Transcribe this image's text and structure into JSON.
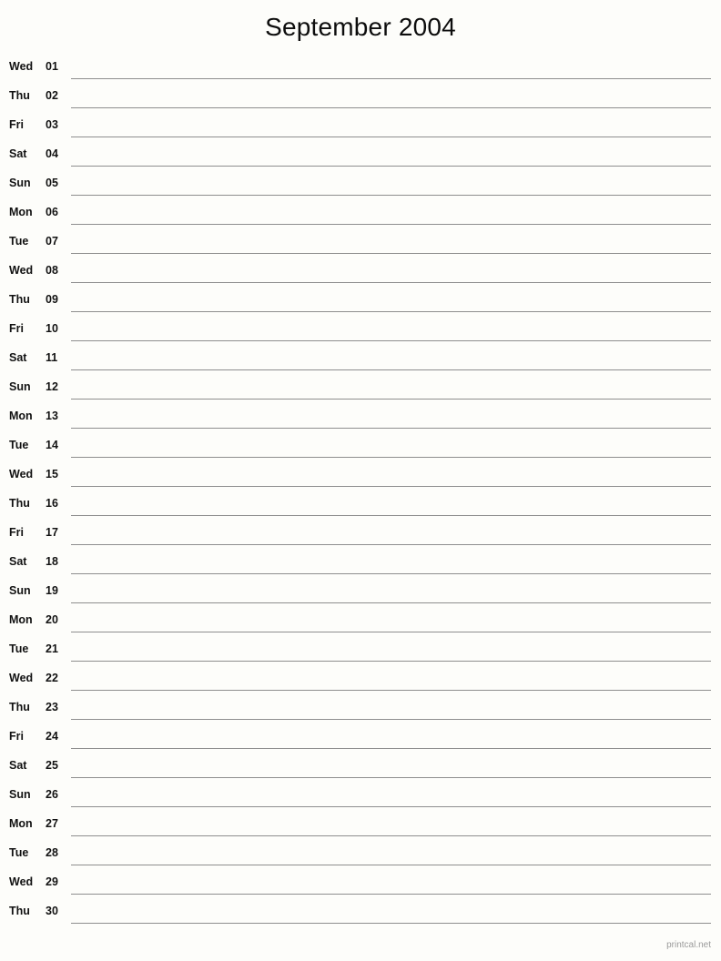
{
  "document": {
    "type": "printable-monthly-notes-calendar",
    "title": "September 2004",
    "month": "September",
    "year": "2004"
  },
  "footer": {
    "credit": "printcal.net"
  },
  "colors": {
    "background": "#fdfdfa",
    "text": "#121212",
    "rule_line": "#8e8e8e",
    "footer_text": "#9b9b9b"
  },
  "days": [
    {
      "weekday": "Wed",
      "daynum": "01"
    },
    {
      "weekday": "Thu",
      "daynum": "02"
    },
    {
      "weekday": "Fri",
      "daynum": "03"
    },
    {
      "weekday": "Sat",
      "daynum": "04"
    },
    {
      "weekday": "Sun",
      "daynum": "05"
    },
    {
      "weekday": "Mon",
      "daynum": "06"
    },
    {
      "weekday": "Tue",
      "daynum": "07"
    },
    {
      "weekday": "Wed",
      "daynum": "08"
    },
    {
      "weekday": "Thu",
      "daynum": "09"
    },
    {
      "weekday": "Fri",
      "daynum": "10"
    },
    {
      "weekday": "Sat",
      "daynum": "11"
    },
    {
      "weekday": "Sun",
      "daynum": "12"
    },
    {
      "weekday": "Mon",
      "daynum": "13"
    },
    {
      "weekday": "Tue",
      "daynum": "14"
    },
    {
      "weekday": "Wed",
      "daynum": "15"
    },
    {
      "weekday": "Thu",
      "daynum": "16"
    },
    {
      "weekday": "Fri",
      "daynum": "17"
    },
    {
      "weekday": "Sat",
      "daynum": "18"
    },
    {
      "weekday": "Sun",
      "daynum": "19"
    },
    {
      "weekday": "Mon",
      "daynum": "20"
    },
    {
      "weekday": "Tue",
      "daynum": "21"
    },
    {
      "weekday": "Wed",
      "daynum": "22"
    },
    {
      "weekday": "Thu",
      "daynum": "23"
    },
    {
      "weekday": "Fri",
      "daynum": "24"
    },
    {
      "weekday": "Sat",
      "daynum": "25"
    },
    {
      "weekday": "Sun",
      "daynum": "26"
    },
    {
      "weekday": "Mon",
      "daynum": "27"
    },
    {
      "weekday": "Tue",
      "daynum": "28"
    },
    {
      "weekday": "Wed",
      "daynum": "29"
    },
    {
      "weekday": "Thu",
      "daynum": "30"
    }
  ]
}
